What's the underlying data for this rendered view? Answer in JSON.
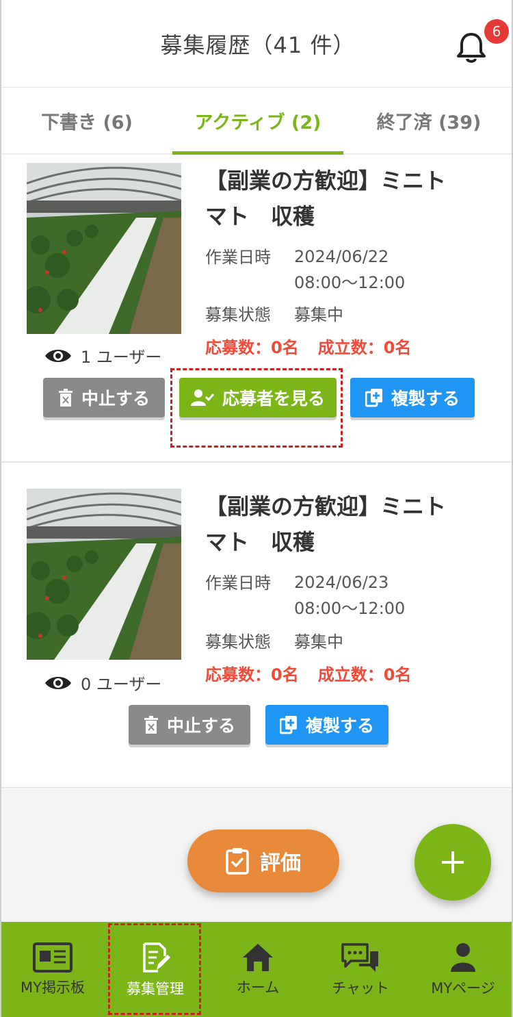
{
  "header": {
    "title": "募集履歴（41 件）",
    "notification_count": "6"
  },
  "tabs": [
    {
      "label": "下書き (6)"
    },
    {
      "label": "アクティブ (2)"
    },
    {
      "label": "終了済 (39)"
    }
  ],
  "active_tab": "アクティブ (2)",
  "cards": [
    {
      "title_line1": "【副業の方歓迎】ミニト",
      "title_line2": "マト　収穫",
      "date_label": "作業日時",
      "date": "2024/06/22",
      "time": "08:00～12:00",
      "status_label": "募集状態",
      "status": "募集中",
      "applicants": "応募数：0名",
      "matched": "成立数：0名",
      "views": "1 ユーザー",
      "buttons": {
        "cancel": "中止する",
        "view_applicants": "応募者を見る",
        "duplicate": "複製する"
      }
    },
    {
      "title_line1": "【副業の方歓迎】ミニト",
      "title_line2": "マト　収穫",
      "date_label": "作業日時",
      "date": "2024/06/23",
      "time": "08:00～12:00",
      "status_label": "募集状態",
      "status": "募集中",
      "applicants": "応募数：0名",
      "matched": "成立数：0名",
      "views": "0 ユーザー",
      "buttons": {
        "cancel": "中止する",
        "duplicate": "複製する"
      }
    }
  ],
  "evaluate_button": "評価",
  "fab_icon": "plus-icon",
  "bottom_nav": [
    {
      "label": "MY掲示板",
      "icon": "board-icon"
    },
    {
      "label": "募集管理",
      "icon": "edit-document-icon"
    },
    {
      "label": "ホーム",
      "icon": "home-icon"
    },
    {
      "label": "チャット",
      "icon": "chat-icon"
    },
    {
      "label": "MYページ",
      "icon": "person-icon"
    }
  ],
  "colors": {
    "accent_green": "#7cb518",
    "blue": "#1f96f3",
    "gray": "#8a8a8a",
    "orange": "#e8893a",
    "red_text": "#f04a3a",
    "highlight_red": "#cc1f1f"
  }
}
